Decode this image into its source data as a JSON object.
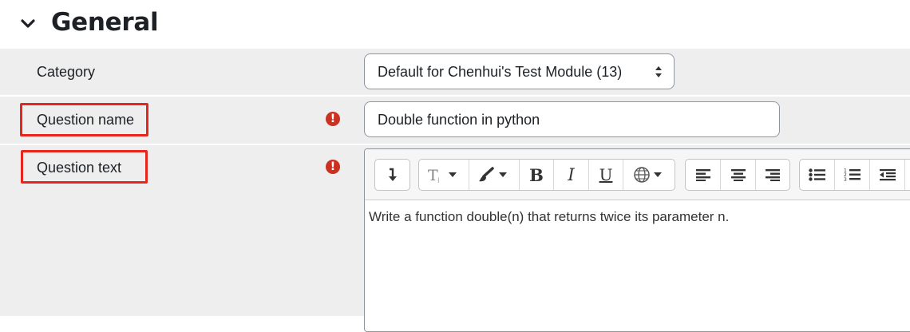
{
  "section": {
    "title": "General",
    "icon": "chevron-down-icon"
  },
  "fields": {
    "category": {
      "label": "Category",
      "value": "Default for Chenhui's Test Module (13)"
    },
    "question_name": {
      "label": "Question name",
      "value": "Double function in python",
      "required_icon": "!"
    },
    "question_text": {
      "label": "Question text",
      "required_icon": "!",
      "content": "Write a function double(n) that returns twice its parameter n."
    }
  },
  "editor_toolbar": {
    "bold": "B",
    "italic": "I",
    "underline": "U",
    "buttons": [
      "collapse-icon",
      "font-style-icon",
      "paintbrush-icon",
      "bold-icon",
      "italic-icon",
      "underline-icon",
      "language-icon",
      "align-left-icon",
      "align-center-icon",
      "align-right-icon",
      "unordered-list-icon",
      "ordered-list-icon",
      "outdent-icon"
    ]
  },
  "colors": {
    "highlight": "#e8251c",
    "required": "#ca3120",
    "row_bg": "#eeeeee"
  }
}
